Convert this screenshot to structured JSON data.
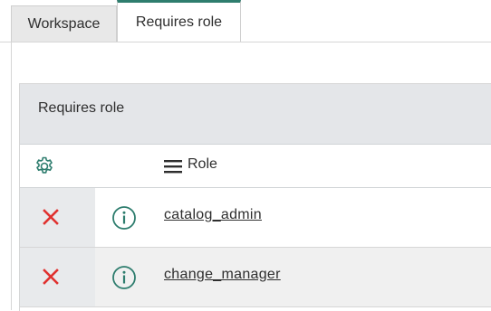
{
  "tabs": [
    {
      "label": "Workspace"
    },
    {
      "label": "Requires role"
    }
  ],
  "panel": {
    "title": "Requires role",
    "columns": {
      "role_header": "Role"
    },
    "rows": [
      {
        "role": "catalog_admin"
      },
      {
        "role": "change_manager"
      }
    ]
  },
  "colors": {
    "accent": "#2e7d6e",
    "delete": "#e0312f",
    "header_bg": "#e4e6e9"
  },
  "icons": {
    "settings": "gear-icon",
    "column_menu": "menu-icon",
    "delete": "close-icon",
    "info": "info-icon"
  }
}
